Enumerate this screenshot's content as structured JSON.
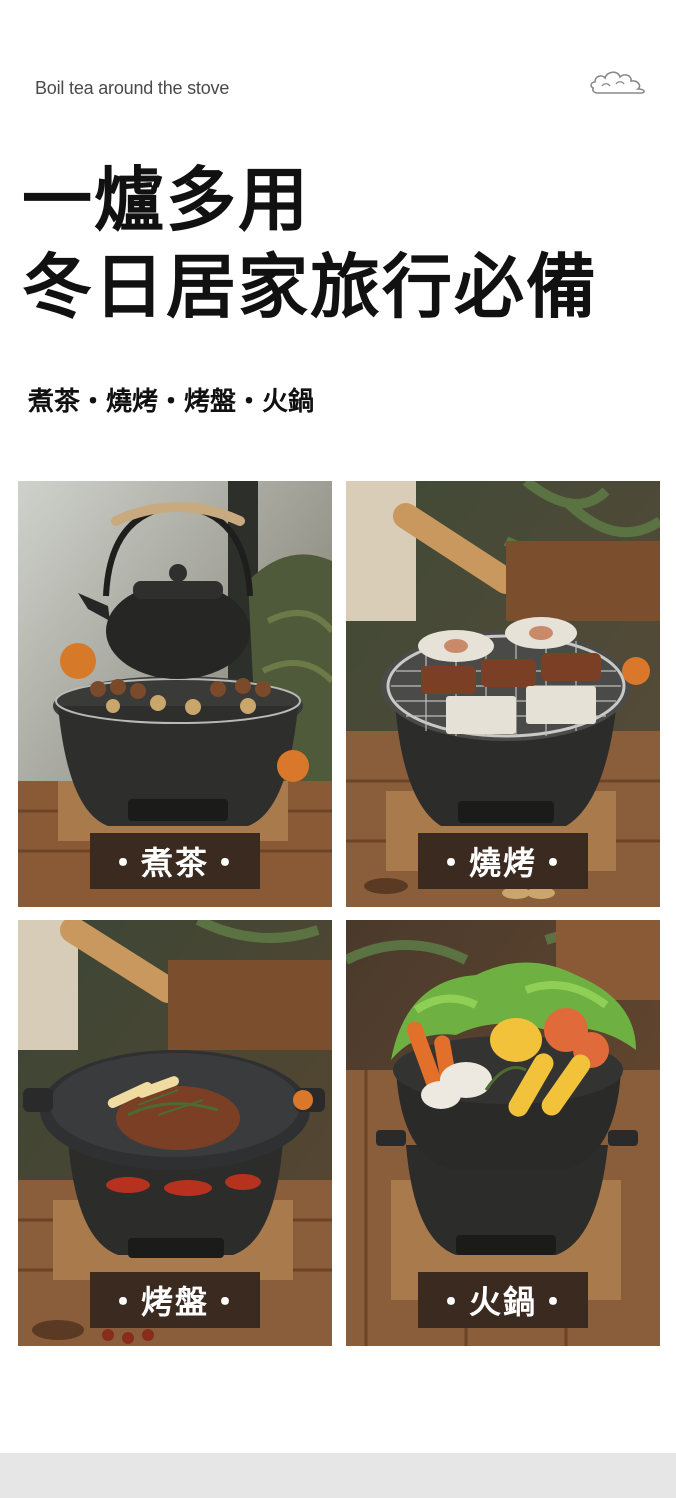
{
  "header": {
    "tagline": "Boil tea around the stove",
    "headline_line1": "一爐多用",
    "headline_line2": "冬日居家旅行必備",
    "subline": "煮茶・燒烤・烤盤・火鍋"
  },
  "icons": {
    "decoration": "cloud-icon"
  },
  "panels": [
    {
      "label": "・煮茶・",
      "scene": "cast-iron teapot on round charcoal stove with chestnuts and nuts"
    },
    {
      "label": "・燒烤・",
      "scene": "grill grate with meat, tofu and scallops on round charcoal stove"
    },
    {
      "label": "・烤盤・",
      "scene": "griddle plate with steak and rosemary on round charcoal stove"
    },
    {
      "label": "・火鍋・",
      "scene": "hot pot with vegetables, mushrooms, corn and carrots on round charcoal stove"
    }
  ],
  "colors": {
    "label_bg": "#3a2a1f",
    "headline": "#111111",
    "bottom_band": "#e6e6e6"
  }
}
